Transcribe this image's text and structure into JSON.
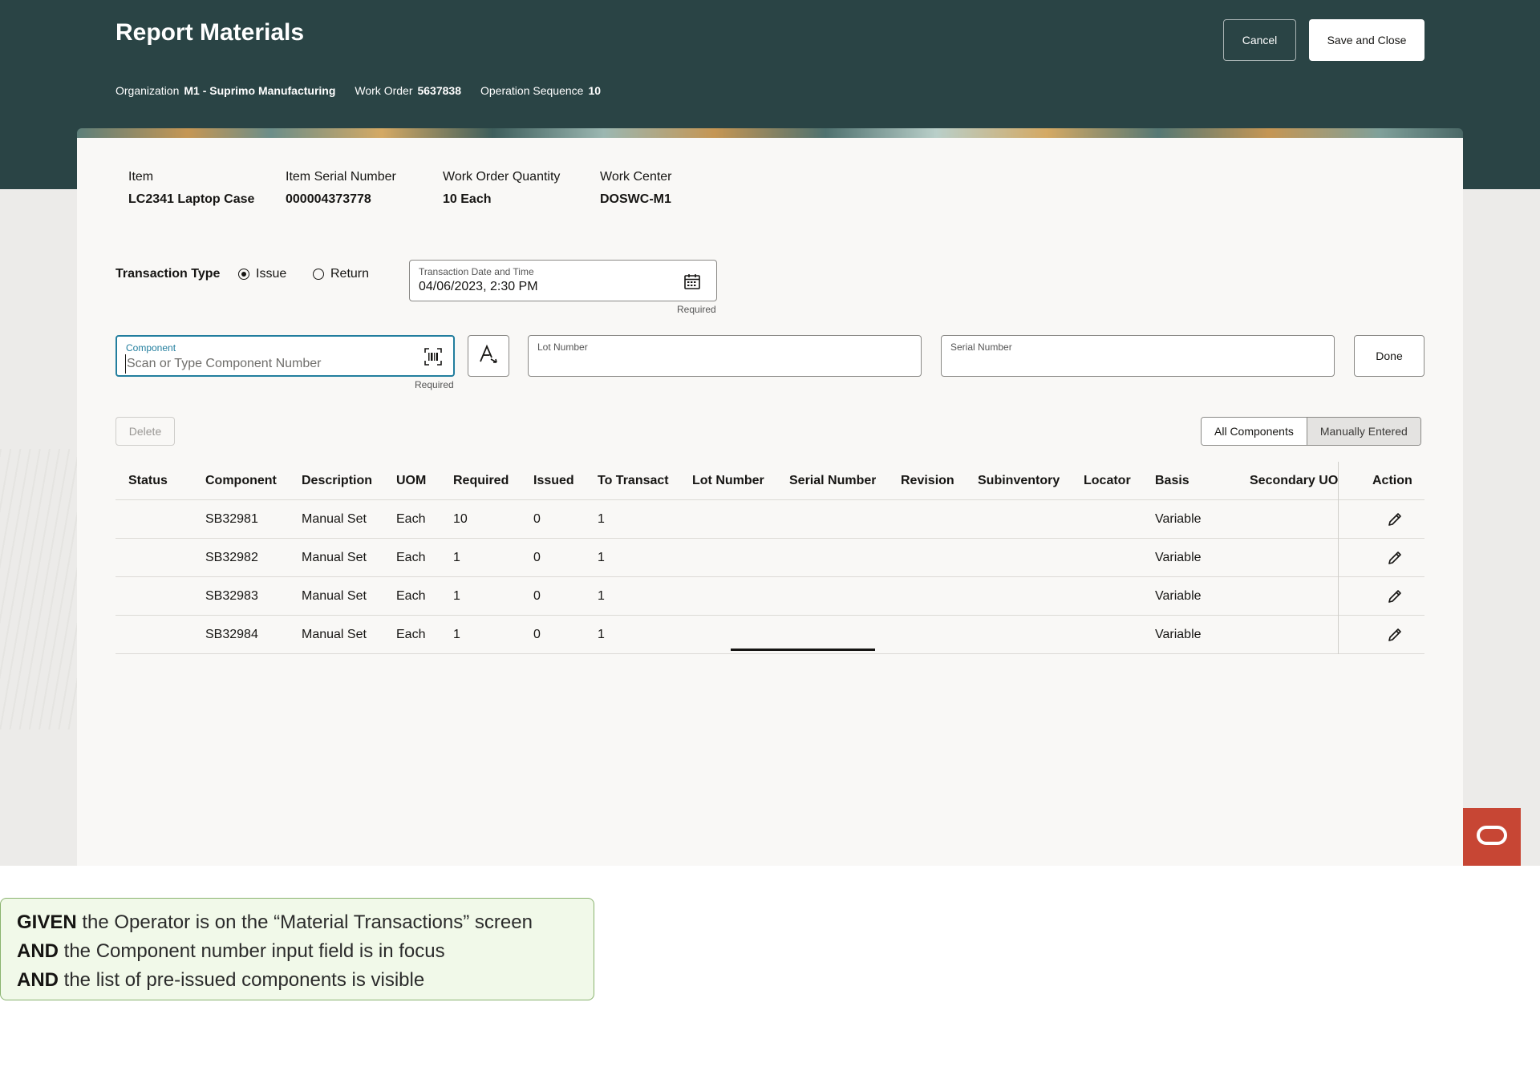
{
  "header": {
    "title": "Report Materials",
    "cancel_label": "Cancel",
    "save_label": "Save and Close",
    "context": [
      {
        "label": "Organization",
        "value": "M1 - Suprimo Manufacturing"
      },
      {
        "label": "Work Order",
        "value": "5637838"
      },
      {
        "label": "Operation Sequence",
        "value": "10"
      }
    ]
  },
  "info": [
    {
      "label": "Item",
      "value": "LC2341 Laptop Case"
    },
    {
      "label": "Item Serial Number",
      "value": "000004373778"
    },
    {
      "label": "Work Order Quantity",
      "value": "10 Each"
    },
    {
      "label": "Work Center",
      "value": "DOSWC-M1"
    }
  ],
  "transaction": {
    "type_label": "Transaction Type",
    "options": [
      "Issue",
      "Return"
    ],
    "selected": "Issue",
    "datetime_label": "Transaction Date and Time",
    "datetime_value": "04/06/2023, 2:30 PM",
    "required": "Required"
  },
  "component": {
    "label": "Component",
    "placeholder": "Scan or Type Component Number",
    "required": "Required"
  },
  "lot_label": "Lot Number",
  "serial_label": "Serial Number",
  "done_label": "Done",
  "delete_label": "Delete",
  "filter": {
    "all_label": "All Components",
    "manual_label": "Manually Entered",
    "selected": "Manually Entered"
  },
  "table": {
    "columns": [
      "Status",
      "Component",
      "Description",
      "UOM",
      "Required",
      "Issued",
      "To Transact",
      "Lot Number",
      "Serial Number",
      "Revision",
      "Subinventory",
      "Locator",
      "Basis",
      "Secondary UOM",
      "Action"
    ],
    "rows": [
      {
        "status": "",
        "component": "SB32981",
        "description": "Manual Set",
        "uom": "Each",
        "required": "10",
        "issued": "0",
        "to_transact": "1",
        "basis": "Variable"
      },
      {
        "status": "",
        "component": "SB32982",
        "description": "Manual Set",
        "uom": "Each",
        "required": "1",
        "issued": "0",
        "to_transact": "1",
        "basis": "Variable"
      },
      {
        "status": "",
        "component": "SB32983",
        "description": "Manual Set",
        "uom": "Each",
        "required": "1",
        "issued": "0",
        "to_transact": "1",
        "basis": "Variable"
      },
      {
        "status": "",
        "component": "SB32984",
        "description": "Manual Set",
        "uom": "Each",
        "required": "1",
        "issued": "0",
        "to_transact": "1",
        "basis": "Variable"
      }
    ]
  },
  "note": {
    "lines": [
      {
        "keyword": "GIVEN",
        "text": " the Operator is on the “Material Transactions” screen"
      },
      {
        "keyword": "AND",
        "text": " the Component number input field is in focus"
      },
      {
        "keyword": "AND",
        "text": " the list of pre-issued components is visible"
      }
    ]
  },
  "colors": {
    "header_bg": "#2a4445",
    "focus": "#227e9e",
    "oracle": "#c74634",
    "note_bg": "#f1f9e9",
    "note_border": "#8ab36f"
  }
}
